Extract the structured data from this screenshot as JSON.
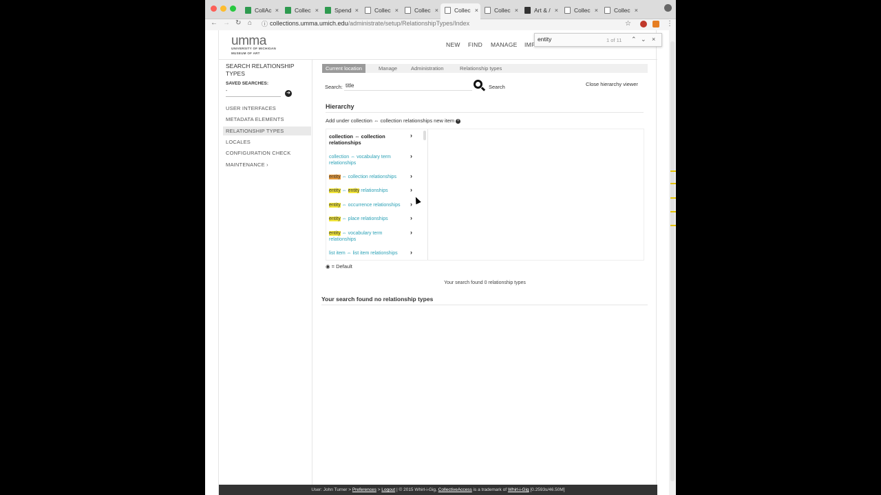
{
  "browser": {
    "tabs": [
      {
        "label": "CollAc",
        "icon": "sheets-icon"
      },
      {
        "label": "Collec",
        "icon": "sheets-icon"
      },
      {
        "label": "Spend",
        "icon": "sheets-icon"
      },
      {
        "label": "Collec",
        "icon": "page-icon"
      },
      {
        "label": "Collec",
        "icon": "page-icon"
      },
      {
        "label": "Collec",
        "icon": "page-icon",
        "active": true
      },
      {
        "label": "Collec",
        "icon": "page-icon"
      },
      {
        "label": "Art & /",
        "icon": "grid-icon"
      },
      {
        "label": "Collec",
        "icon": "page-icon"
      },
      {
        "label": "Collec",
        "icon": "page-icon"
      }
    ],
    "url_host": "collections.umma.umich.edu",
    "url_path": "/administrate/setup/RelationshipTypes/Index",
    "find": {
      "query": "entity",
      "count": "1 of 11"
    }
  },
  "header": {
    "logo": "umma",
    "logo_line1": "UNIVERSITY OF MICHIGAN",
    "logo_line2": "MUSEUM OF ART",
    "nav": [
      "NEW",
      "FIND",
      "MANAGE",
      "IMP"
    ]
  },
  "sidebar": {
    "title": "SEARCH RELATIONSHIP TYPES",
    "saved_label": "SAVED SEARCHES:",
    "saved_value": "-",
    "items": [
      {
        "label": "USER INTERFACES"
      },
      {
        "label": "METADATA ELEMENTS"
      },
      {
        "label": "RELATIONSHIP TYPES",
        "active": true
      },
      {
        "label": "LOCALES"
      },
      {
        "label": "CONFIGURATION CHECK"
      },
      {
        "label": "MAINTENANCE ›"
      }
    ]
  },
  "breadcrumb": [
    "Current location",
    "Manage",
    "Administration",
    "Relationship types"
  ],
  "search": {
    "label": "Search:",
    "value": "title",
    "button": "Search"
  },
  "close_hierarchy": "Close hierarchy viewer",
  "hierarchy": {
    "title": "Hierarchy",
    "add_under": "Add under collection ⇔ collection relationships new item",
    "items": [
      {
        "pre": "",
        "hl": "",
        "post": "collection ⇔ collection relationships",
        "bold": true
      },
      {
        "pre": "",
        "hl": "",
        "post": "collection ⇔ vocabulary term relationships"
      },
      {
        "pre": "",
        "hl": "entity",
        "post": " ⇔ collection relationships",
        "current": true
      },
      {
        "pre": "",
        "hl": "entity",
        "mid": " ⇔ ",
        "hl2": "entity",
        "post": " relationships"
      },
      {
        "pre": "",
        "hl": "entity",
        "post": " ⇔ occurrence relationships"
      },
      {
        "pre": "",
        "hl": "entity",
        "post": " ⇔ place relationships"
      },
      {
        "pre": "",
        "hl": "entity",
        "post": " ⇔ vocabulary term relationships"
      },
      {
        "pre": "",
        "hl": "",
        "post": "list item ⇔ list item relationships"
      }
    ]
  },
  "default_note": "◉ = Default",
  "found_count": "Your search found 0 relationship types",
  "no_results": "Your search found no relationship types",
  "footer": {
    "user": "User: John Turner >",
    "preferences": "Preferences",
    "sep": ">",
    "logout": "Logout",
    "copy": "| © 2015 Whirl-i-Gig,",
    "ca": "CollectiveAccess",
    "tm": "is a trademark of",
    "wig": "Whirl-i-Gig",
    "stats": "[0.2593s/46.50M]"
  },
  "colors": {
    "link": "#2aa0b5",
    "highlight": "#f3e73a",
    "current_highlight": "#e89b3c",
    "footer_bg": "#333333"
  }
}
